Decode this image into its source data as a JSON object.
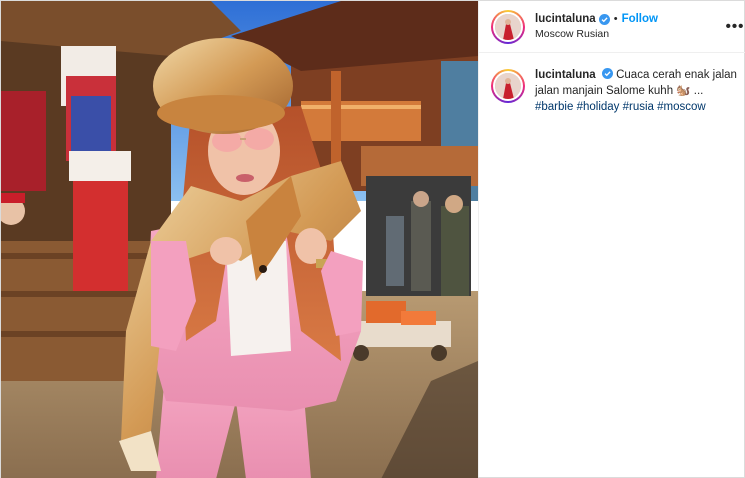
{
  "post": {
    "username": "lucintaluna",
    "follow_label": "Follow",
    "separator": "•",
    "location": "Moscow Rusian",
    "more_label": "•••",
    "caption_text": "Cuaca cerah enak jalan jalan manjain Salome kuhh 🐿️ ...",
    "hashtags": [
      "#barbie",
      "#holiday",
      "#rusia",
      "#moscow"
    ]
  },
  "colors": {
    "link": "#0095f6",
    "hashtag": "#00376b",
    "verified": "#3897f0"
  },
  "icons": [
    "verified-badge-icon",
    "more-options-icon"
  ]
}
